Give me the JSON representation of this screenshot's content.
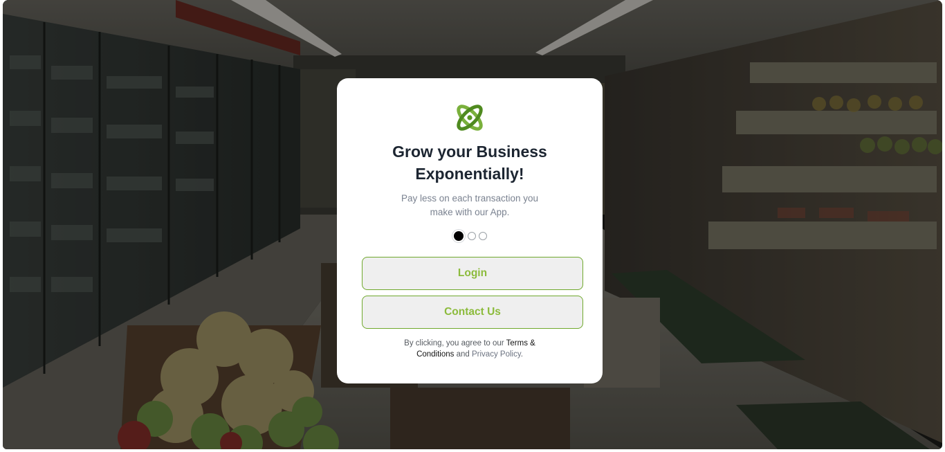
{
  "background": {
    "scene": "supermarket aisle with refrigerated cases, produce shelves and melon crate",
    "overlay_color": "#000000"
  },
  "card": {
    "logo_icon": "atom-orbit-logo",
    "logo_colors": [
      "#7ab03c",
      "#4f8a1f"
    ],
    "title_line1": "Grow your Business",
    "title_line2": "Exponentially!",
    "subtitle_line1": "Pay less on each transaction you",
    "subtitle_line2": "make with our App.",
    "carousel": {
      "total": 3,
      "active_index": 0
    },
    "login_label": "Login",
    "contact_label": "Contact Us",
    "legal": {
      "prefix": "By clicking, you agree to our",
      "terms_link": "Terms & Conditions",
      "conjunction": "and",
      "privacy_link": "Privacy Policy",
      "suffix": "."
    }
  },
  "colors": {
    "accent_green": "#8cbb3c",
    "button_border": "#6fa82c",
    "title": "#1c2531"
  }
}
